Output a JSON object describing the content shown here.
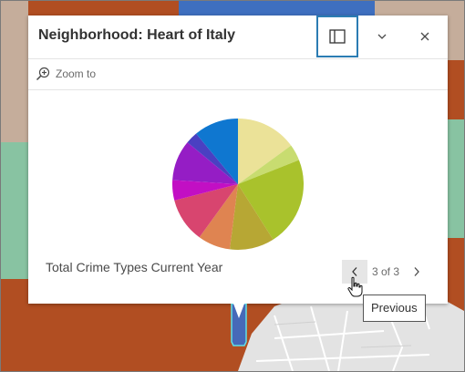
{
  "popup": {
    "title": "Neighborhood: Heart of Italy",
    "dock_icon": "dock-side-icon",
    "collapse_icon": "chevron-down-icon",
    "close_icon": "close-icon",
    "zoom_icon": "zoom-in-icon",
    "zoom_label": "Zoom to",
    "chart_caption": "Total Crime Types Current Year",
    "pager": {
      "prev_icon": "chevron-left-icon",
      "next_icon": "chevron-right-icon",
      "count_text": "3 of 3"
    }
  },
  "tooltip": {
    "text": "Previous"
  },
  "chart_data": {
    "type": "pie",
    "title": "",
    "slices": [
      {
        "value": 15,
        "color": "#ebe298"
      },
      {
        "value": 4,
        "color": "#c8dc70"
      },
      {
        "value": 22,
        "color": "#a9c22c"
      },
      {
        "value": 11,
        "color": "#b7a734"
      },
      {
        "value": 8,
        "color": "#df8451"
      },
      {
        "value": 11,
        "color": "#d8456f"
      },
      {
        "value": 5,
        "color": "#c20fc4"
      },
      {
        "value": 10,
        "color": "#951dc5"
      },
      {
        "value": 3,
        "color": "#4a40c2"
      },
      {
        "value": 11,
        "color": "#0f77d0"
      }
    ]
  },
  "colors": {
    "accent": "#2b7cb3",
    "map_brick": "#b14e22",
    "map_teal": "#88c3a2",
    "map_tan": "#c5ad9b",
    "map_blue": "#3e6fbf",
    "map_gray": "#e3e3e3"
  }
}
